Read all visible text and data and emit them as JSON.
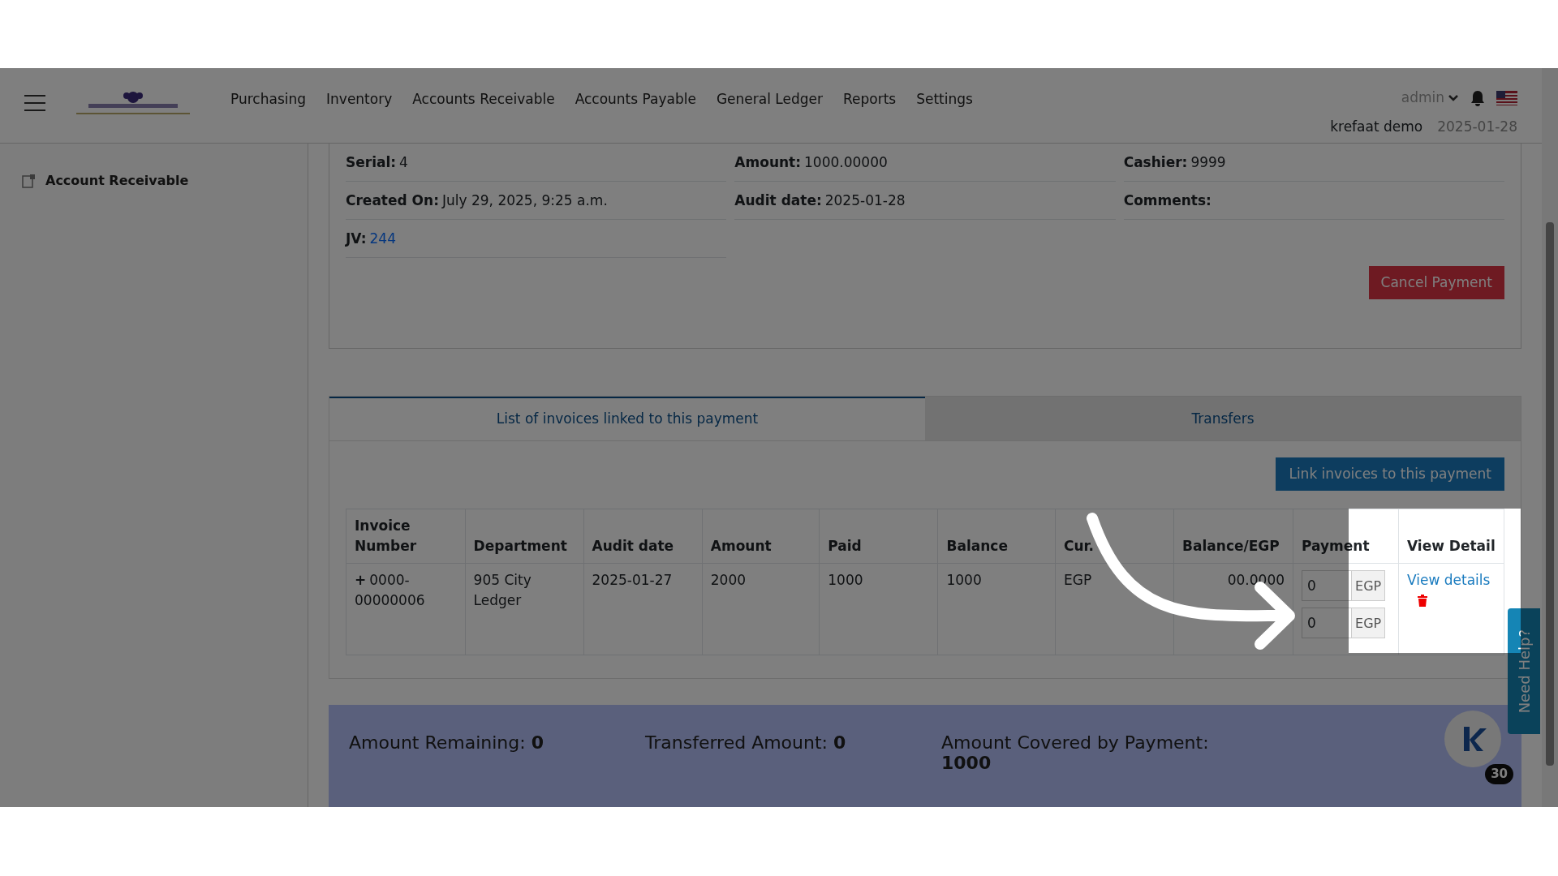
{
  "nav": {
    "menu": [
      "Purchasing",
      "Inventory",
      "Accounts Receivable",
      "Accounts Payable",
      "General Ledger",
      "Reports",
      "Settings"
    ],
    "user": "admin",
    "company": "krefaat demo",
    "date": "2025-01-28"
  },
  "sidebar": {
    "items": [
      {
        "label": "Account Receivable"
      }
    ]
  },
  "details": {
    "fields": [
      {
        "label": "Serial:",
        "value": "4",
        "kind": "text"
      },
      {
        "label": "Amount:",
        "value": "1000.00000",
        "kind": "text"
      },
      {
        "label": "Cashier:",
        "value": "9999",
        "kind": "text"
      },
      {
        "label": "Created On:",
        "value": "July 29, 2025, 9:25 a.m.",
        "kind": "text"
      },
      {
        "label": "Audit date:",
        "value": "2025-01-28",
        "kind": "text"
      },
      {
        "label": "Comments:"
      },
      {
        "label": "JV:",
        "value": "244",
        "kind": "link"
      }
    ],
    "cancel_button": "Cancel Payment"
  },
  "tabs": [
    {
      "label": "List of invoices linked to this payment",
      "selected": true
    },
    {
      "label": "Transfers",
      "selected": false
    }
  ],
  "link_button": "Link invoices to this payment",
  "table": {
    "columns": [
      "Invoice Number",
      "Department",
      "Audit date",
      "Amount",
      "Paid",
      "Balance",
      "Cur.",
      "Balance/EGP",
      "Payment",
      "View Detail"
    ],
    "rows": [
      {
        "expand": "+",
        "invoice": "0000-00000006",
        "department": "905 City Ledger",
        "audit_date": "2025-01-27",
        "amount": "2000",
        "paid": "1000",
        "balance": "1000",
        "currency": "EGP",
        "balance_egp": "00.0000",
        "payments": [
          {
            "value": "0",
            "currency": "EGP"
          },
          {
            "value": "0",
            "currency": "EGP"
          }
        ],
        "view": "View details"
      }
    ]
  },
  "summary": [
    {
      "label": "Amount Remaining:",
      "value": "0"
    },
    {
      "label": "Transferred Amount:",
      "value": "0"
    },
    {
      "label": "Amount Covered by Payment:",
      "value": "1000"
    }
  ],
  "help_tab": "Need Help?",
  "chat": {
    "badge": "30"
  }
}
